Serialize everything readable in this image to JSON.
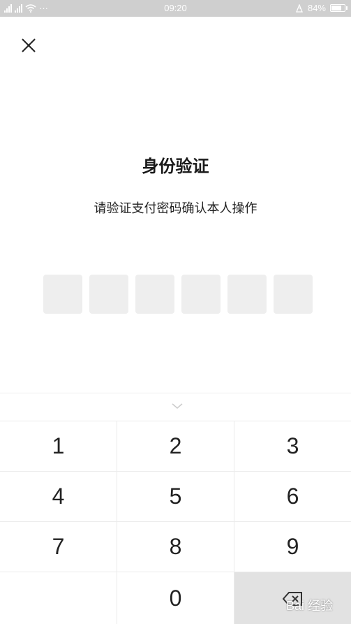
{
  "status_bar": {
    "time": "09:20",
    "battery": "84%",
    "battery_level": 0.84,
    "more_dots": "···"
  },
  "page": {
    "title": "身份验证",
    "subtitle": "请验证支付密码确认本人操作"
  },
  "pin": {
    "length": 6
  },
  "keypad": {
    "rows": [
      [
        "1",
        "2",
        "3"
      ],
      [
        "4",
        "5",
        "6"
      ],
      [
        "7",
        "8",
        "9"
      ],
      [
        "",
        "0",
        "delete"
      ]
    ]
  },
  "watermark": "Bai 经验",
  "colors": {
    "status_bar_bg": "#cfcfcf",
    "pin_box_bg": "#eeeeee",
    "delete_key_bg": "#e2e2e2"
  },
  "icons": [
    "signal-icon",
    "wifi-icon",
    "alarm-icon",
    "battery-icon",
    "close-icon",
    "chevron-down-icon",
    "backspace-icon"
  ]
}
